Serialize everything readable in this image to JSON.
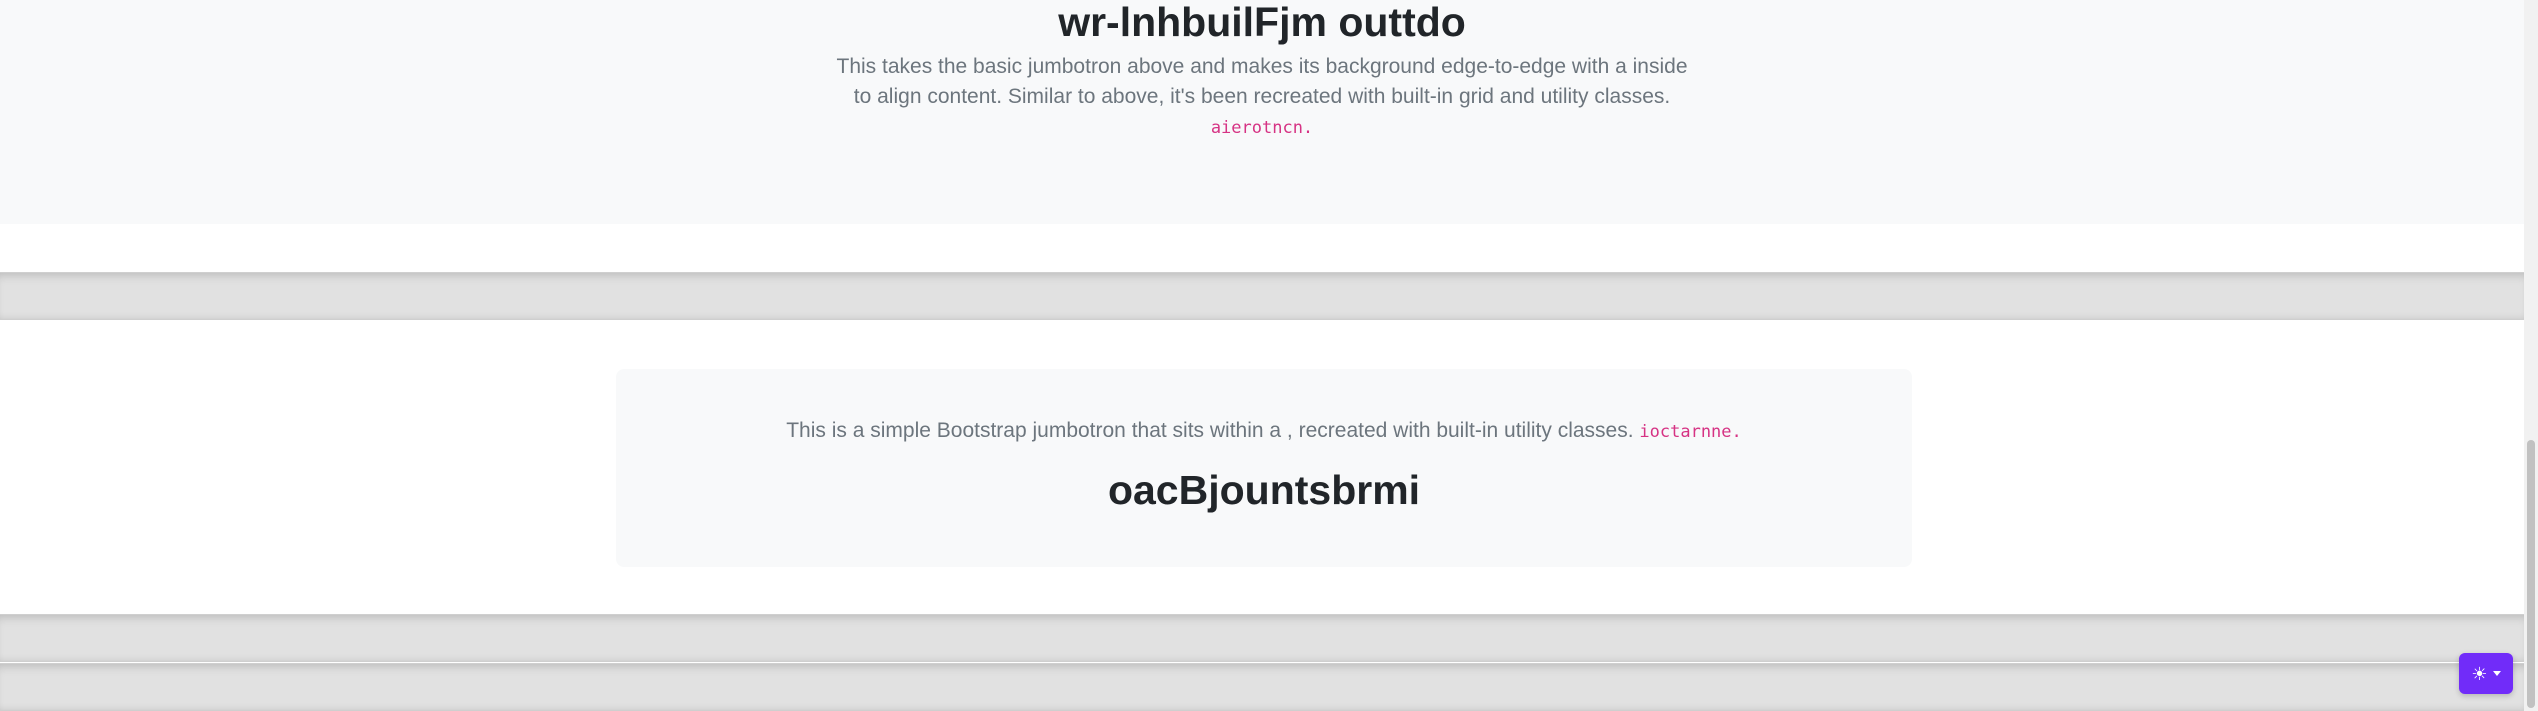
{
  "hero_fluid": {
    "title": "wr-lnhbuilFjm outtdo",
    "lead": "This takes the basic jumbotron above and makes its background edge-to-edge with a inside to align content. Similar to above, it's been recreated with built-in grid and utility classes. ",
    "code": "aierotncn."
  },
  "hero_contained": {
    "lead": "This is a simple Bootstrap jumbotron that sits within a , recreated with built-in utility classes. ",
    "code": "ioctarnne.",
    "title": "oacBjountsbrmi"
  },
  "theme_toggle": {
    "icon": "sun-icon",
    "accent": "#712cf9"
  }
}
